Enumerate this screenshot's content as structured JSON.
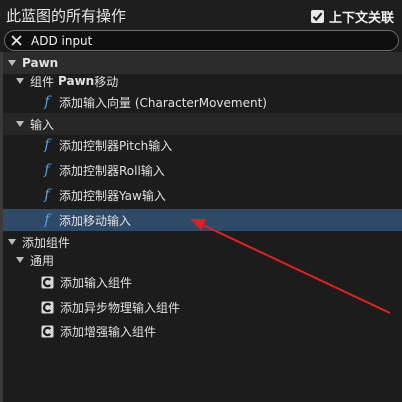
{
  "header": {
    "title": "此蓝图的所有操作",
    "context_sensitive_label": "上下文关联",
    "context_sensitive_checked": true
  },
  "search": {
    "value": "ADD input"
  },
  "tree": {
    "pawn": {
      "label": "Pawn"
    },
    "pawn_component": {
      "label_prefix": "组件",
      "label_bold": "Pawn",
      "label_suffix": "移动"
    },
    "add_input_vector": {
      "label": "添加输入向量 (CharacterMovement)"
    },
    "input_cat": {
      "label": "输入"
    },
    "add_pitch": {
      "label": "添加控制器Pitch输入"
    },
    "add_roll": {
      "label": "添加控制器Roll输入"
    },
    "add_yaw": {
      "label": "添加控制器Yaw输入"
    },
    "add_movement": {
      "label": "添加移动输入"
    },
    "add_component": {
      "label": "添加组件"
    },
    "common": {
      "label": "通用"
    },
    "add_input_comp": {
      "label": "添加输入组件"
    },
    "add_async_physics": {
      "label": "添加异步物理输入组件"
    },
    "add_enhanced": {
      "label": "添加增强输入组件"
    }
  },
  "colors": {
    "accent_function": "#4ea4f0",
    "selected_row": "#2f4a66",
    "annotation_arrow": "#e02020"
  },
  "icons": {
    "function": "function-f-icon",
    "component": "component-c-icon",
    "clear": "close-icon",
    "checkbox": "checkmark-icon",
    "expand": "triangle-down-icon"
  }
}
